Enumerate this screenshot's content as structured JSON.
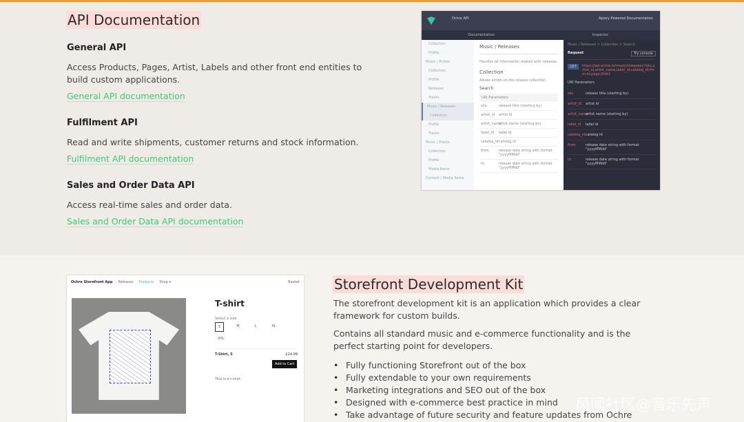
{
  "api": {
    "title": "API Documentation",
    "sections": [
      {
        "heading": "General API",
        "text": "Access Products, Pages, Artist, Labels and other front end entities to build custom applications.",
        "link": "General API documentation"
      },
      {
        "heading": "Fulfilment API",
        "text": "Read and write shipments, customer returns and stock information.",
        "link": "Fulfilment API documentation"
      },
      {
        "heading": "Sales and Order Data API",
        "text": "Access real-time sales and order data.",
        "link": "Sales and Order Data API documentation"
      }
    ]
  },
  "docs_shot": {
    "app": "Ochre API",
    "powered": "Apiary Powered Documentation",
    "tabs": [
      "Documentation",
      "Inspector"
    ],
    "sidebar": [
      "Collection",
      "Profile",
      "Music / Artists",
      "Collection",
      "Profile",
      "Releases",
      "Tracks",
      "Music / Releases",
      "Collection",
      "Profile",
      "Tracks",
      "Music / Tracks",
      "Collection",
      "Profile",
      "Media Items",
      "Content / Media Items"
    ],
    "heading": "Music / Releases",
    "heading_desc": "Handles all information related with releases.",
    "collection": "Collection",
    "collection_desc": "Allows action on the release collection",
    "search": "Search",
    "uri_params": "URI Parameters",
    "params": [
      [
        "sku",
        "release title (starting by)"
      ],
      [
        "artist_id",
        "artist id"
      ],
      [
        "artist_name",
        "artist name (starting by)"
      ],
      [
        "label_id",
        "label id"
      ],
      [
        "catalog_id",
        "catalog id"
      ],
      [
        "from",
        "release date string with format \"yyyyMMdd\""
      ],
      [
        "to",
        "release date string with format \"yyyyMMdd\""
      ]
    ],
    "breadcrumb": "Music / Releases > Collection > Search",
    "request": "Request",
    "try": "Try console",
    "method": "GET",
    "url": "https://api.ochre.io/music/releases{?sku,artist_id,artist_name,label_id,catalog_id,from,to,page,limit}"
  },
  "store_shot": {
    "nav": [
      "Ochre Storefront App",
      "Releases",
      "Products",
      "Shop ▾"
    ],
    "basket": "Basket",
    "product": "T-shirt",
    "select_size": "Select a size",
    "sizes": [
      "S",
      "M",
      "L",
      "XL",
      "XXL"
    ],
    "line": "T-Shirt, S",
    "price": "£24.99",
    "add": "Add to Cart",
    "desc": "This is a t-shirt"
  },
  "sdk": {
    "title": "Storefront Development Kit",
    "p1": "The storefront development kit is an application which provides a clear framework for custom builds.",
    "p2": "Contains all standard music and e-commerce functionality and is the perfect starting point for developers.",
    "bullets": [
      "Fully functioning Storefront out of the box",
      "Fully extendable to your own requirements",
      "Marketing integrations and SEO out of the box",
      "Designed with e-commerce best practice in mind",
      "Take advantage of future security and feature updates from Ochre"
    ]
  },
  "watermark": "风闻社区@音乐先声"
}
